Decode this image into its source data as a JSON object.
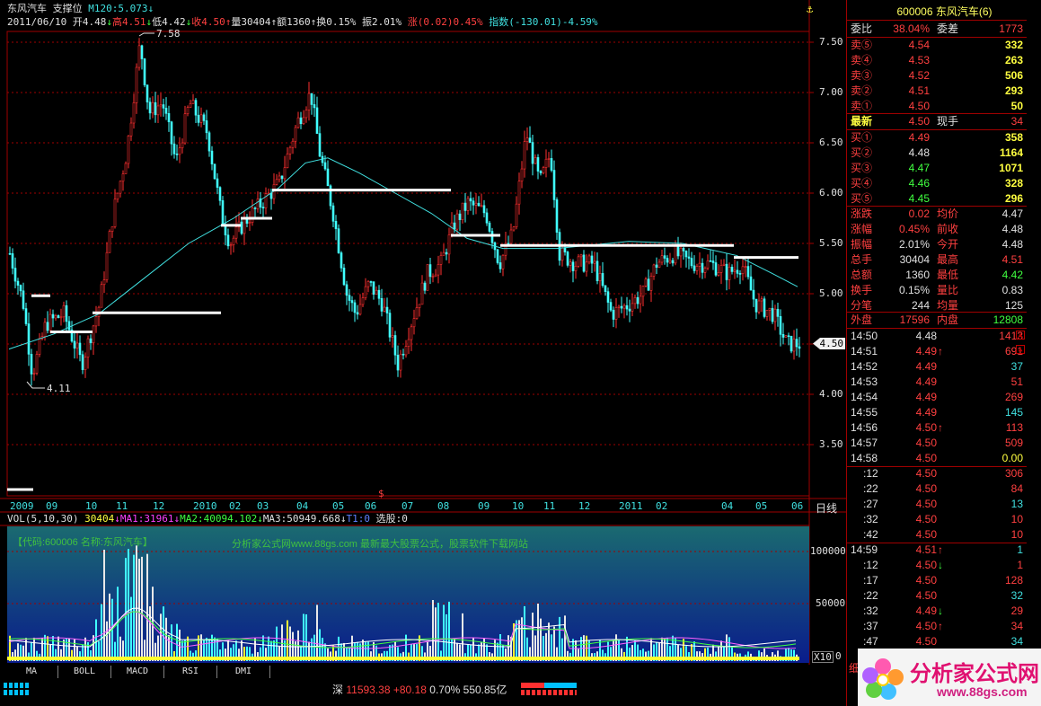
{
  "header": {
    "stock_name": "东风汽车",
    "indicator_name": "支撑位",
    "m120_label": "M120:5.073",
    "m120_arrow": "↓",
    "date": "2011/06/10",
    "open": "开4.48",
    "high": "高4.51",
    "low": "低4.42",
    "close": "收4.50",
    "volume": "量30404",
    "amount": "额1360",
    "turnover": "换0.15%",
    "amplitude": "振2.01%",
    "change": "涨(0.02)0.45%",
    "index": "指数(-130.01)-4.59%"
  },
  "price_axis": {
    "ticks": [
      "7.50",
      "7.00",
      "6.50",
      "6.00",
      "5.50",
      "5.00",
      "4.50",
      "4.00",
      "3.50"
    ],
    "current_price_tag": "4.50",
    "max_label": "7.58",
    "min_label": "4.11"
  },
  "x_axis": {
    "labels": [
      "2009",
      "09",
      "10",
      "11",
      "12",
      "2010",
      "02",
      "03",
      "04",
      "05",
      "06",
      "07",
      "08",
      "09",
      "10",
      "11",
      "12",
      "2011",
      "02",
      "04",
      "05",
      "06"
    ],
    "period_button": "日线",
    "marker": "$"
  },
  "volume_header": {
    "vol": "VOL(5,10,30)",
    "vol_value": "30404",
    "ma1": "MA1:31961",
    "ma2": "MA2:40094.102",
    "ma3": "MA3:50949.668",
    "t1": "T1:0",
    "xuangu": "选股:0"
  },
  "volume_axis": {
    "ticks": [
      "100000",
      "50000",
      "0"
    ],
    "multiplier": "X10"
  },
  "volume_panel": {
    "code_label": "【代码:600006 名称:东风汽车】",
    "site_text": "分析家公式网www.88gs.com 最新最大股票公式，股票软件下载网站"
  },
  "tabs": [
    "MA",
    "BOLL",
    "MACD",
    "RSI",
    "DMI"
  ],
  "status_bar": {
    "market": "深",
    "index_value": "11593.38",
    "index_change": "+80.18",
    "index_pct": "0.70%",
    "turnover": "550.85亿"
  },
  "quote": {
    "title": "600006 东风汽车(6)",
    "weibi_label": "委比",
    "weibi": "38.04%",
    "weicha_label": "委差",
    "weicha": "1773",
    "asks": [
      {
        "label": "卖⑤",
        "price": "4.54",
        "vol": "332"
      },
      {
        "label": "卖④",
        "price": "4.53",
        "vol": "263"
      },
      {
        "label": "卖③",
        "price": "4.52",
        "vol": "506"
      },
      {
        "label": "卖②",
        "price": "4.51",
        "vol": "293"
      },
      {
        "label": "卖①",
        "price": "4.50",
        "vol": "50"
      }
    ],
    "latest_label": "最新",
    "latest": "4.50",
    "xianshou_label": "现手",
    "xianshou": "34",
    "bids": [
      {
        "label": "买①",
        "price": "4.49",
        "vol": "358"
      },
      {
        "label": "买②",
        "price": "4.48",
        "vol": "1164"
      },
      {
        "label": "买③",
        "price": "4.47",
        "vol": "1071"
      },
      {
        "label": "买④",
        "price": "4.46",
        "vol": "328"
      },
      {
        "label": "买⑤",
        "price": "4.45",
        "vol": "296"
      }
    ],
    "stats": [
      {
        "l1": "涨跌",
        "v1": "0.02",
        "l2": "均价",
        "v2": "4.47"
      },
      {
        "l1": "涨幅",
        "v1": "0.45%",
        "l2": "前收",
        "v2": "4.48"
      },
      {
        "l1": "振幅",
        "v1": "2.01%",
        "l2": "今开",
        "v2": "4.48"
      },
      {
        "l1": "总手",
        "v1": "30404",
        "l2": "最高",
        "v2": "4.51"
      },
      {
        "l1": "总额",
        "v1": "1360",
        "l2": "最低",
        "v2": "4.42"
      },
      {
        "l1": "换手",
        "v1": "0.15%",
        "l2": "量比",
        "v2": "0.83"
      },
      {
        "l1": "分笔",
        "v1": "244",
        "l2": "均量",
        "v2": "125"
      }
    ],
    "waipan_label": "外盘",
    "waipan": "17596",
    "neipan_label": "内盘",
    "neipan": "12808",
    "ticks": [
      {
        "t": "14:50",
        "p": "4.48",
        "a": "",
        "v": "1413"
      },
      {
        "t": "14:51",
        "p": "4.49",
        "a": "↑",
        "v": "691"
      },
      {
        "t": "14:52",
        "p": "4.49",
        "a": "",
        "v": "37"
      },
      {
        "t": "14:53",
        "p": "4.49",
        "a": "",
        "v": "51"
      },
      {
        "t": "14:54",
        "p": "4.49",
        "a": "",
        "v": "269"
      },
      {
        "t": "14:55",
        "p": "4.49",
        "a": "",
        "v": "145"
      },
      {
        "t": "14:56",
        "p": "4.50",
        "a": "↑",
        "v": "113"
      },
      {
        "t": "14:57",
        "p": "4.50",
        "a": "",
        "v": "509"
      },
      {
        "t": "14:58",
        "p": "4.50",
        "a": "",
        "v": "0.00"
      },
      {
        "t": ":12",
        "p": "4.50",
        "a": "",
        "v": "306"
      },
      {
        "t": ":22",
        "p": "4.50",
        "a": "",
        "v": "84"
      },
      {
        "t": ":27",
        "p": "4.50",
        "a": "",
        "v": "13"
      },
      {
        "t": ":32",
        "p": "4.50",
        "a": "",
        "v": "10"
      },
      {
        "t": ":42",
        "p": "4.50",
        "a": "",
        "v": "10"
      },
      {
        "t": "14:59",
        "p": "4.51",
        "a": "↑",
        "v": "1"
      },
      {
        "t": ":12",
        "p": "4.50",
        "a": "↓",
        "v": "1"
      },
      {
        "t": ":17",
        "p": "4.50",
        "a": "",
        "v": "128"
      },
      {
        "t": ":22",
        "p": "4.50",
        "a": "",
        "v": "32"
      },
      {
        "t": ":32",
        "p": "4.49",
        "a": "↓",
        "v": "29"
      },
      {
        "t": ":37",
        "p": "4.50",
        "a": "↑",
        "v": "34"
      },
      {
        "t": ":47",
        "p": "4.50",
        "a": "",
        "v": "34"
      }
    ],
    "footer_char": "细"
  },
  "logo": {
    "text": "分析家公式网",
    "url": "www.88gs.com"
  }
}
